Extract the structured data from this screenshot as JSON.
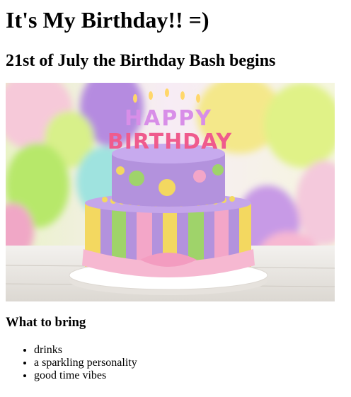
{
  "page": {
    "title": "It's My Birthday!! =)",
    "subtitle": "21st of July the Birthday Bash begins",
    "image": {
      "subject": "birthday-cake-with-balloons",
      "candles_text": [
        "HAPPY",
        "BIRTHDAY"
      ]
    },
    "bring_heading": "What to bring",
    "bring_items": [
      "drinks",
      "a sparkling personality",
      "good time vibes"
    ]
  },
  "colors": {
    "text": "#000000",
    "background": "#ffffff",
    "cake_top": "#b392dd",
    "cake_stripe_pink": "#f3a6c8",
    "cake_stripe_yellow": "#f3d860",
    "cake_stripe_green": "#9fd36a"
  }
}
